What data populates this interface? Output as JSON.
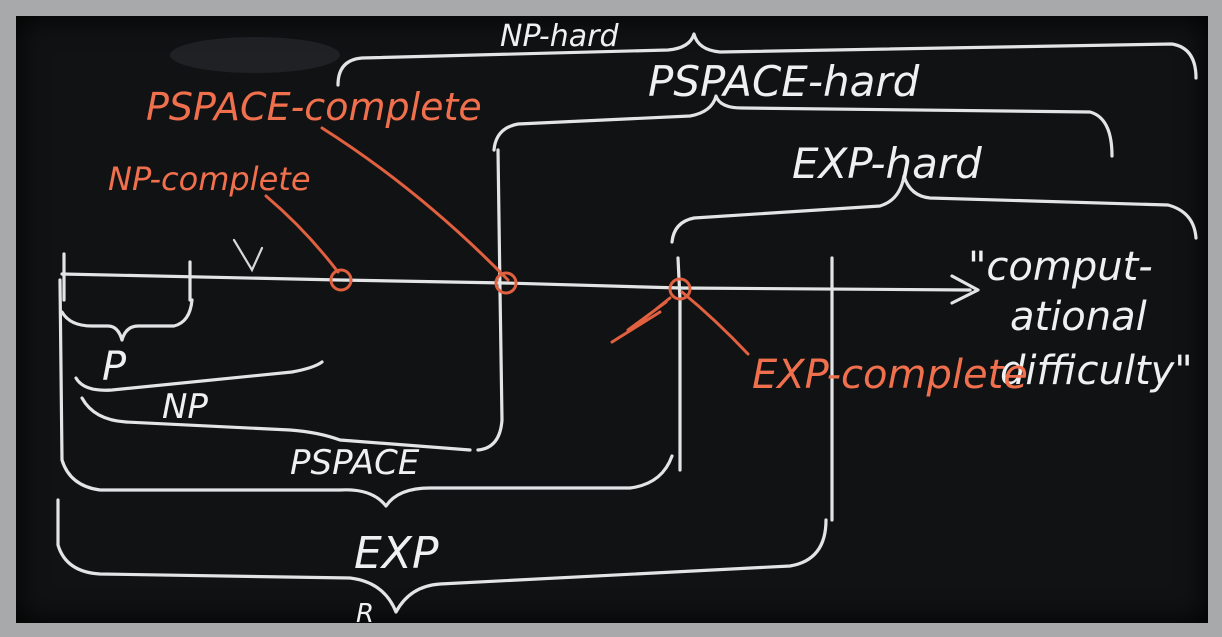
{
  "labels": {
    "np_hard": "NP-hard",
    "pspace_hard": "PSPACE-hard",
    "exp_hard": "EXP-hard",
    "pspace_complete": "PSPACE-complete",
    "np_complete": "NP-complete",
    "exp_complete": "EXP-complete",
    "axis_line1": "\"comput-",
    "axis_line2": "ational",
    "axis_line3": "difficulty\"",
    "p": "P",
    "np": "NP",
    "pspace": "PSPACE",
    "exp": "EXP",
    "r": "R"
  },
  "colors": {
    "board": "#111214",
    "frame": "#a7a9ab",
    "chalk_white": "#e2e4e6",
    "chalk_orange": "#e0603f"
  }
}
